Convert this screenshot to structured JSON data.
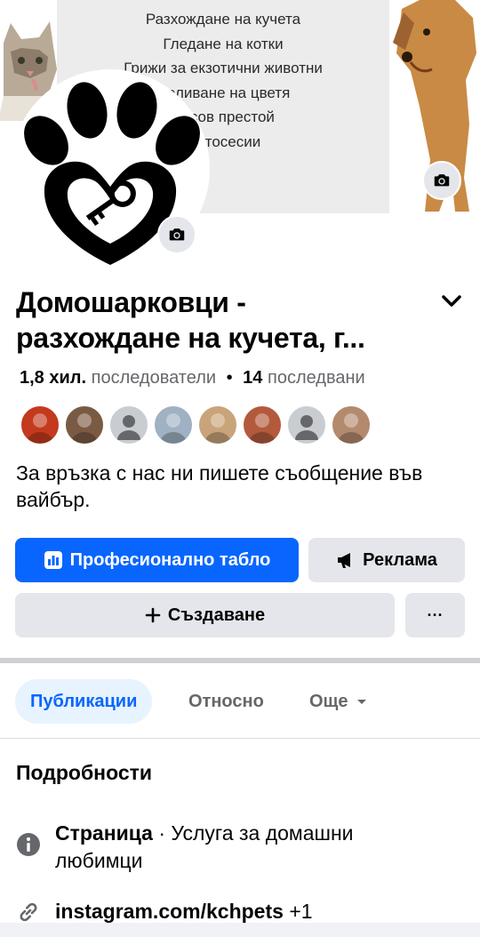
{
  "cover": {
    "lines": [
      "Разхождане на кучета",
      "Гледане на котки",
      "Грижи за екзотични животни",
      "Поливане на цветя",
      "Часов престой",
      "Фотосесии"
    ]
  },
  "profile": {
    "name_line1": "Домошарковци -",
    "name_line2": "разхождане на кучета, г...",
    "followers_count": "1,8 хил.",
    "followers_label": "последователи",
    "separator": "•",
    "following_count": "14",
    "following_label": "последвани",
    "bio": "За връзка с нас ни пишете съобщение във вайбър."
  },
  "friends": [
    {
      "name": "friend-1",
      "color": "#c43a1e"
    },
    {
      "name": "friend-2",
      "color": "#7b5a44"
    },
    {
      "name": "friend-3",
      "color": "#c9ccd1"
    },
    {
      "name": "friend-4",
      "color": "#9fb1c2"
    },
    {
      "name": "friend-5",
      "color": "#c9a47a"
    },
    {
      "name": "friend-6",
      "color": "#b35a3c"
    },
    {
      "name": "friend-7",
      "color": "#c9ccd1"
    },
    {
      "name": "friend-8",
      "color": "#b48a6e"
    }
  ],
  "actions": {
    "dashboard": "Професионално табло",
    "ads": "Реклама",
    "create": "Създаване",
    "more": "···"
  },
  "tabs": {
    "posts": "Публикации",
    "about": "Относно",
    "more": "Още"
  },
  "details": {
    "title": "Подробности",
    "category_label": "Страница",
    "category_sep": " · ",
    "category_value": "Услуга за домашни любимци",
    "link": "instagram.com/kchpets",
    "link_extra": "+1"
  },
  "colors": {
    "accent": "#0866ff",
    "button_grey": "#e4e6eb",
    "muted_text": "#65676b"
  }
}
